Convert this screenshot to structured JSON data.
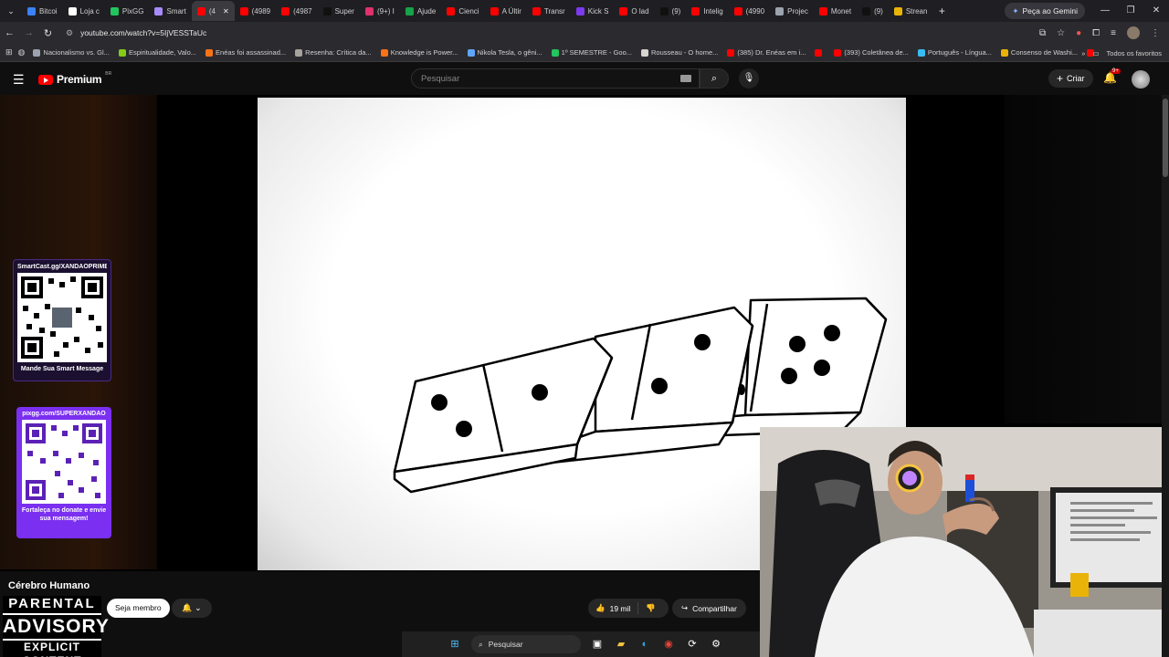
{
  "browser": {
    "tabs": [
      {
        "label": "Bitcoi",
        "color": "#3b82f6"
      },
      {
        "label": "Loja c",
        "color": "#ffffff"
      },
      {
        "label": "PixGG",
        "color": "#22c55e"
      },
      {
        "label": "Smart",
        "color": "#a78bfa"
      },
      {
        "label": "(4",
        "color": "#ff0000",
        "active": true
      },
      {
        "label": "(4989",
        "color": "#ff0000"
      },
      {
        "label": "(4987",
        "color": "#ff0000"
      },
      {
        "label": "Super",
        "color": "#111111"
      },
      {
        "label": "(9+) I",
        "color": "#e1306c"
      },
      {
        "label": "Ajude",
        "color": "#16a34a"
      },
      {
        "label": "Cienci",
        "color": "#ff0000"
      },
      {
        "label": "A Últir",
        "color": "#ff0000"
      },
      {
        "label": "Transr",
        "color": "#ff0000"
      },
      {
        "label": "Kick S",
        "color": "#7c3aed"
      },
      {
        "label": "O lad",
        "color": "#ff0000"
      },
      {
        "label": "(9)",
        "color": "#111111"
      },
      {
        "label": "Intelig",
        "color": "#ff0000"
      },
      {
        "label": "(4990",
        "color": "#ff0000"
      },
      {
        "label": "Projec",
        "color": "#9ca3af"
      },
      {
        "label": "Monet",
        "color": "#ff0000"
      },
      {
        "label": "(9)",
        "color": "#111111"
      },
      {
        "label": "Strean",
        "color": "#eab308"
      }
    ],
    "new_tab_symbol": "+",
    "gemini_label": "Peça ao Gemini",
    "url": "youtube.com/watch?v=5IjVESSTaUc",
    "bookmarks": [
      {
        "label": "Nacionalismo vs. Gl...",
        "color": "#9ca3af"
      },
      {
        "label": "Espiritualidade, Valo...",
        "color": "#84cc16"
      },
      {
        "label": "Enéas foi assassinad...",
        "color": "#f97316"
      },
      {
        "label": "Resenha: Crítica da...",
        "color": "#a8a29e"
      },
      {
        "label": "Knowledge is Power...",
        "color": "#f97316"
      },
      {
        "label": "Nikola Tesla, o gêni...",
        "color": "#60a5fa"
      },
      {
        "label": "1º SEMESTRE - Goo...",
        "color": "#22c55e"
      },
      {
        "label": "Rousseau - O home...",
        "color": "#d6d3d1"
      },
      {
        "label": "(385) Dr. Enéas em i...",
        "color": "#ff0000"
      },
      {
        "label": "",
        "color": "#ff0000"
      },
      {
        "label": "(393) Coletânea de...",
        "color": "#ff0000"
      },
      {
        "label": "Português - Língua...",
        "color": "#38bdf8"
      },
      {
        "label": "Consenso de Washi...",
        "color": "#eab308"
      },
      {
        "label": "",
        "color": "#ff0000"
      }
    ],
    "all_favorites_label": "Todos os favoritos"
  },
  "youtube": {
    "logo_text": "Premium",
    "logo_region": "BR",
    "search_placeholder": "Pesquisar",
    "create_label": "Criar",
    "notification_count": "9+",
    "channel_name": "Cérebro Humano",
    "member_button": "Seja membro",
    "like_count": "19 mil",
    "share_label": "Compartilhar"
  },
  "overlay": {
    "qr1_top": "SmartCast.gg/XANDAOPRIME",
    "qr1_bottom": "Mande Sua Smart Message",
    "qr2_top": "pixgg.com/SUPERXANDAO",
    "qr2_bottom": "Fortaleça no donate e envie sua mensagem!",
    "advisory_line1": "PARENTAL",
    "advisory_line2": "ADVISORY",
    "advisory_line3": "EXPLICIT CONTENT"
  },
  "taskbar": {
    "search_label": "Pesquisar"
  }
}
